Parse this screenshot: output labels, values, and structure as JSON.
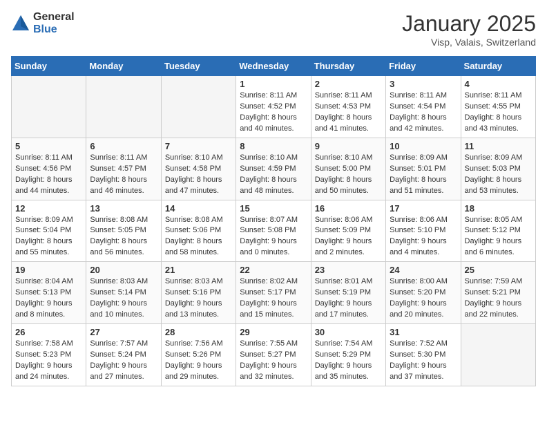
{
  "header": {
    "logo_general": "General",
    "logo_blue": "Blue",
    "title": "January 2025",
    "location": "Visp, Valais, Switzerland"
  },
  "weekdays": [
    "Sunday",
    "Monday",
    "Tuesday",
    "Wednesday",
    "Thursday",
    "Friday",
    "Saturday"
  ],
  "weeks": [
    [
      {
        "day": "",
        "info": ""
      },
      {
        "day": "",
        "info": ""
      },
      {
        "day": "",
        "info": ""
      },
      {
        "day": "1",
        "info": "Sunrise: 8:11 AM\nSunset: 4:52 PM\nDaylight: 8 hours\nand 40 minutes."
      },
      {
        "day": "2",
        "info": "Sunrise: 8:11 AM\nSunset: 4:53 PM\nDaylight: 8 hours\nand 41 minutes."
      },
      {
        "day": "3",
        "info": "Sunrise: 8:11 AM\nSunset: 4:54 PM\nDaylight: 8 hours\nand 42 minutes."
      },
      {
        "day": "4",
        "info": "Sunrise: 8:11 AM\nSunset: 4:55 PM\nDaylight: 8 hours\nand 43 minutes."
      }
    ],
    [
      {
        "day": "5",
        "info": "Sunrise: 8:11 AM\nSunset: 4:56 PM\nDaylight: 8 hours\nand 44 minutes."
      },
      {
        "day": "6",
        "info": "Sunrise: 8:11 AM\nSunset: 4:57 PM\nDaylight: 8 hours\nand 46 minutes."
      },
      {
        "day": "7",
        "info": "Sunrise: 8:10 AM\nSunset: 4:58 PM\nDaylight: 8 hours\nand 47 minutes."
      },
      {
        "day": "8",
        "info": "Sunrise: 8:10 AM\nSunset: 4:59 PM\nDaylight: 8 hours\nand 48 minutes."
      },
      {
        "day": "9",
        "info": "Sunrise: 8:10 AM\nSunset: 5:00 PM\nDaylight: 8 hours\nand 50 minutes."
      },
      {
        "day": "10",
        "info": "Sunrise: 8:09 AM\nSunset: 5:01 PM\nDaylight: 8 hours\nand 51 minutes."
      },
      {
        "day": "11",
        "info": "Sunrise: 8:09 AM\nSunset: 5:03 PM\nDaylight: 8 hours\nand 53 minutes."
      }
    ],
    [
      {
        "day": "12",
        "info": "Sunrise: 8:09 AM\nSunset: 5:04 PM\nDaylight: 8 hours\nand 55 minutes."
      },
      {
        "day": "13",
        "info": "Sunrise: 8:08 AM\nSunset: 5:05 PM\nDaylight: 8 hours\nand 56 minutes."
      },
      {
        "day": "14",
        "info": "Sunrise: 8:08 AM\nSunset: 5:06 PM\nDaylight: 8 hours\nand 58 minutes."
      },
      {
        "day": "15",
        "info": "Sunrise: 8:07 AM\nSunset: 5:08 PM\nDaylight: 9 hours\nand 0 minutes."
      },
      {
        "day": "16",
        "info": "Sunrise: 8:06 AM\nSunset: 5:09 PM\nDaylight: 9 hours\nand 2 minutes."
      },
      {
        "day": "17",
        "info": "Sunrise: 8:06 AM\nSunset: 5:10 PM\nDaylight: 9 hours\nand 4 minutes."
      },
      {
        "day": "18",
        "info": "Sunrise: 8:05 AM\nSunset: 5:12 PM\nDaylight: 9 hours\nand 6 minutes."
      }
    ],
    [
      {
        "day": "19",
        "info": "Sunrise: 8:04 AM\nSunset: 5:13 PM\nDaylight: 9 hours\nand 8 minutes."
      },
      {
        "day": "20",
        "info": "Sunrise: 8:03 AM\nSunset: 5:14 PM\nDaylight: 9 hours\nand 10 minutes."
      },
      {
        "day": "21",
        "info": "Sunrise: 8:03 AM\nSunset: 5:16 PM\nDaylight: 9 hours\nand 13 minutes."
      },
      {
        "day": "22",
        "info": "Sunrise: 8:02 AM\nSunset: 5:17 PM\nDaylight: 9 hours\nand 15 minutes."
      },
      {
        "day": "23",
        "info": "Sunrise: 8:01 AM\nSunset: 5:19 PM\nDaylight: 9 hours\nand 17 minutes."
      },
      {
        "day": "24",
        "info": "Sunrise: 8:00 AM\nSunset: 5:20 PM\nDaylight: 9 hours\nand 20 minutes."
      },
      {
        "day": "25",
        "info": "Sunrise: 7:59 AM\nSunset: 5:21 PM\nDaylight: 9 hours\nand 22 minutes."
      }
    ],
    [
      {
        "day": "26",
        "info": "Sunrise: 7:58 AM\nSunset: 5:23 PM\nDaylight: 9 hours\nand 24 minutes."
      },
      {
        "day": "27",
        "info": "Sunrise: 7:57 AM\nSunset: 5:24 PM\nDaylight: 9 hours\nand 27 minutes."
      },
      {
        "day": "28",
        "info": "Sunrise: 7:56 AM\nSunset: 5:26 PM\nDaylight: 9 hours\nand 29 minutes."
      },
      {
        "day": "29",
        "info": "Sunrise: 7:55 AM\nSunset: 5:27 PM\nDaylight: 9 hours\nand 32 minutes."
      },
      {
        "day": "30",
        "info": "Sunrise: 7:54 AM\nSunset: 5:29 PM\nDaylight: 9 hours\nand 35 minutes."
      },
      {
        "day": "31",
        "info": "Sunrise: 7:52 AM\nSunset: 5:30 PM\nDaylight: 9 hours\nand 37 minutes."
      },
      {
        "day": "",
        "info": ""
      }
    ]
  ]
}
